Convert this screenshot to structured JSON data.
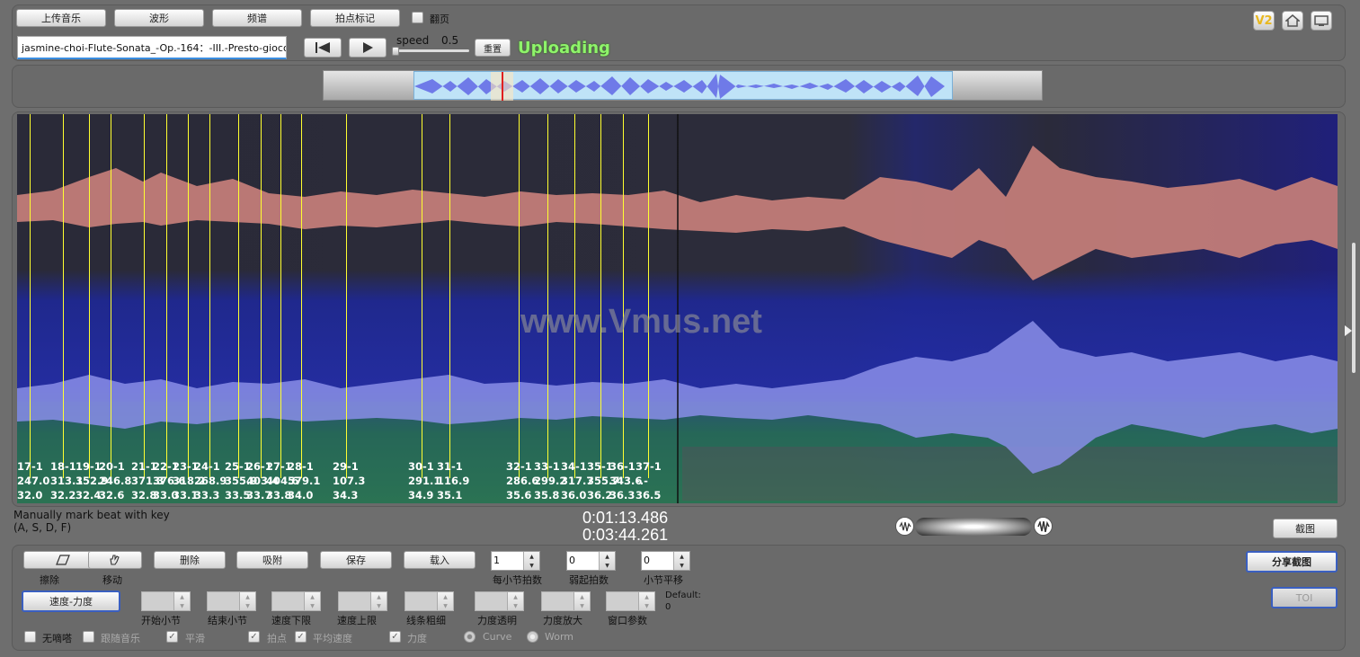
{
  "toolbar": {
    "upload_music": "上传音乐",
    "waveform": "波形",
    "spectrum": "频谱",
    "beat_mark": "拍点标记",
    "page_turn_label": "翻页",
    "filename": "jasmine-choi-Flute-Sonata_-Op.-164：-III.-Presto-giocoso",
    "speed_label": "speed",
    "speed_value": "0.5",
    "reset_label": "重置",
    "status": "Uploading",
    "v2_label": "V2"
  },
  "spectrogram": {
    "watermark": "www.Vmus.net",
    "markers": [
      {
        "line1": "17-1",
        "line2": "247.0",
        "line3": "32.0"
      },
      {
        "line1": "18-1",
        "line2": "313.1",
        "line3": "32.2"
      },
      {
        "line1": "19-1",
        "line2": "352.9",
        "line3": "32.4"
      },
      {
        "line1": "20-1",
        "line2": "246.8",
        "line3": "32.6"
      },
      {
        "line1": "21-1",
        "line2": "371.3",
        "line3": "32.8"
      },
      {
        "line1": "22-1",
        "line2": "376.6",
        "line3": "33.0"
      },
      {
        "line1": "23-1",
        "line2": "318.2",
        "line3": "33.1"
      },
      {
        "line1": "24-1",
        "line2": "268.9",
        "line3": "33.3"
      },
      {
        "line1": "25-1",
        "line2": "355.9",
        "line3": "33.5"
      },
      {
        "line1": "26-1",
        "line2": "403.4",
        "line3": "33.7"
      },
      {
        "line1": "27-1",
        "line2": "404.6",
        "line3": "33.8"
      },
      {
        "line1": "28-1",
        "line2": "579.1",
        "line3": "34.0"
      },
      {
        "line1": "29-1",
        "line2": "107.3",
        "line3": "34.3"
      },
      {
        "line1": "30-1",
        "line2": "291.1",
        "line3": "34.9"
      },
      {
        "line1": "31-1",
        "line2": "116.9",
        "line3": "35.1"
      },
      {
        "line1": "32-1",
        "line2": "286.6",
        "line3": "35.6"
      },
      {
        "line1": "33-1",
        "line2": "299.2",
        "line3": "35.8"
      },
      {
        "line1": "34-1",
        "line2": "317.7",
        "line3": "36.0"
      },
      {
        "line1": "35-1",
        "line2": "355.7",
        "line3": "36.2"
      },
      {
        "line1": "36-1",
        "line2": "343.6",
        "line3": "36.3"
      },
      {
        "line1": "37-1",
        "line2": "-.-",
        "line3": "36.5"
      }
    ]
  },
  "info": {
    "hint_line1": "Manually mark beat with key",
    "hint_line2": "(A, S, D, F)",
    "current_time": "0:01:13.486",
    "total_time": "0:03:44.261",
    "screenshot": "截图"
  },
  "controls": {
    "erase": "擦除",
    "move": "移动",
    "delete": "删除",
    "snap": "吸附",
    "save": "保存",
    "load": "载入",
    "beats_per_bar_value": "1",
    "beats_per_bar_label": "每小节拍数",
    "weak_beats_value": "0",
    "weak_beats_label": "弱起拍数",
    "bar_shift_value": "0",
    "bar_shift_label": "小节平移",
    "share_screenshot": "分享截图",
    "tempo_dynamics": "速度-力度",
    "start_bar": "开始小节",
    "end_bar": "结束小节",
    "tempo_lower": "速度下限",
    "tempo_upper": "速度上限",
    "line_thickness": "线条粗细",
    "dynamics_transparency": "力度透明",
    "dynamics_zoom": "力度放大",
    "window_params": "窗口参数",
    "default_label": "Default:",
    "default_value": "0",
    "toi": "TOI",
    "no_tick": "无嘀嗒",
    "follow_music": "跟随音乐",
    "smooth": "平滑",
    "beat_point": "拍点",
    "avg_tempo": "平均速度",
    "dynamics": "力度",
    "curve": "Curve",
    "worm": "Worm"
  }
}
